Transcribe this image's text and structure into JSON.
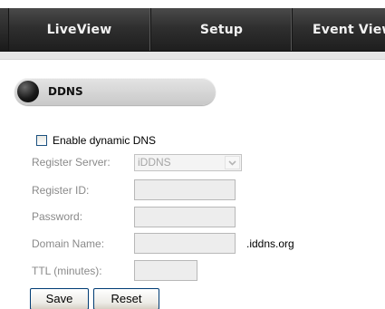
{
  "nav": {
    "tabs": [
      {
        "label": "LiveView"
      },
      {
        "label": "Setup"
      },
      {
        "label": "Event View"
      }
    ]
  },
  "section": {
    "title": "DDNS"
  },
  "form": {
    "enable_label": "Enable dynamic DNS",
    "enable_checked": false,
    "register_server": {
      "label": "Register Server:",
      "selected": "iDDNS",
      "options": [
        "iDDNS"
      ]
    },
    "register_id": {
      "label": "Register ID:",
      "value": ""
    },
    "password": {
      "label": "Password:",
      "value": ""
    },
    "domain_name": {
      "label": "Domain Name:",
      "value": "",
      "suffix": ".iddns.org"
    },
    "ttl": {
      "label": "TTL (minutes):",
      "value": ""
    }
  },
  "buttons": {
    "save": "Save",
    "reset": "Reset"
  },
  "colors": {
    "nav_bg": "#2f2f2f",
    "label_disabled": "#8a8a8a",
    "input_bg": "#ededed",
    "button_border": "#003c74"
  },
  "icons": {
    "section_marker": "black-circle-icon",
    "select_arrow": "chevron-down-icon"
  }
}
